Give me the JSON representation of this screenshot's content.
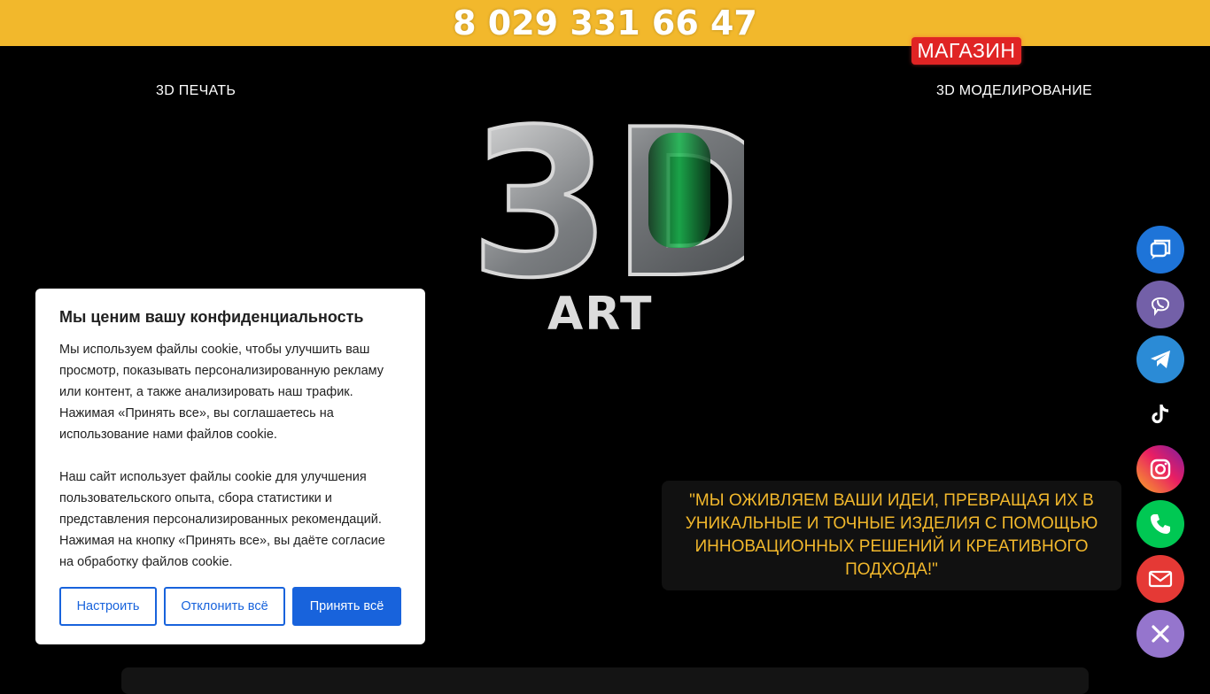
{
  "topbar": {
    "phone": "8 029 331 66 47"
  },
  "header": {
    "shop_label": "МАГАЗИН",
    "nav_print": "3D ПЕЧАТЬ",
    "nav_modeling": "3D МОДЕЛИРОВАНИЕ",
    "logo_main": "3D",
    "logo_sub": "ART"
  },
  "hero": {
    "slogan": "\"МЫ ОЖИВЛЯЕМ ВАШИ ИДЕИ, ПРЕВРАЩАЯ ИХ В УНИКАЛЬНЫЕ И ТОЧНЫЕ ИЗДЕЛИЯ С ПОМОЩЬЮ ИННОВАЦИОННЫХ РЕШЕНИЙ И КРЕАТИВНОГО ПОДХОДА!\""
  },
  "cookie": {
    "title": "Мы ценим вашу конфиденциальность",
    "paragraph1": "Мы используем файлы cookie, чтобы улучшить ваш просмотр, показывать персонализированную рекламу или контент, а также анализировать наш трафик. Нажимая «Принять все», вы соглашаетесь на использование нами файлов cookie.",
    "paragraph2": "Наш сайт использует файлы cookie для улучшения пользовательского опыта, сбора статистики и представления персонализированных рекомендаций. Нажимая на кнопку «Принять все», вы даёте согласие на обработку файлов cookie.",
    "customize_label": "Настроить",
    "reject_label": "Отклонить всё",
    "accept_label": "Принять всё"
  },
  "social": [
    {
      "icon": "chat-icon",
      "color": "#1e74d8"
    },
    {
      "icon": "viber-icon",
      "color": "#7360a8"
    },
    {
      "icon": "telegram-icon",
      "color": "#2b8bd6"
    },
    {
      "icon": "tiktok-icon",
      "color": "#000000"
    },
    {
      "icon": "instagram-icon",
      "color": "#d6317e"
    },
    {
      "icon": "phone-icon",
      "color": "#00c853"
    },
    {
      "icon": "email-icon",
      "color": "#e53935"
    },
    {
      "icon": "close-icon",
      "color": "#9575cd"
    }
  ],
  "colors": {
    "accent_yellow": "#f2b82c",
    "shop_red": "#e02424",
    "cookie_blue": "#1863dc"
  }
}
